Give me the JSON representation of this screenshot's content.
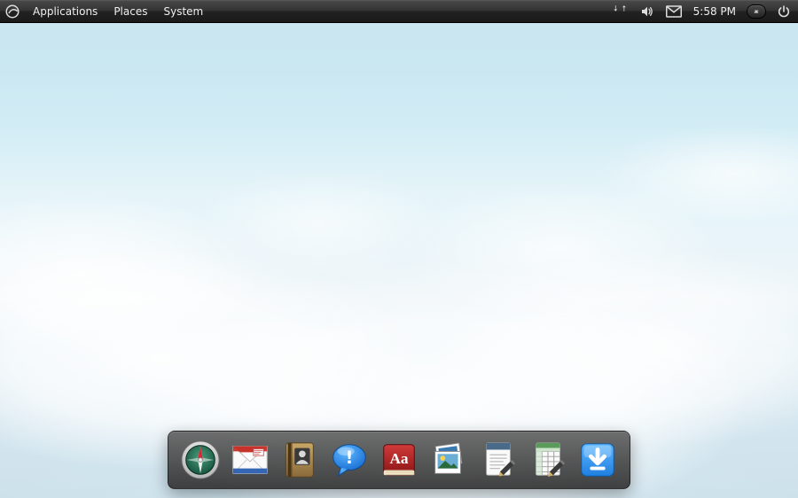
{
  "panel": {
    "menus": {
      "applications": "Applications",
      "places": "Places",
      "system": "System"
    },
    "clock": "5:58 PM"
  },
  "tray": {
    "network": "network-icon",
    "volume": "volume-icon",
    "mail": "mail-icon",
    "user": "user-switch-icon",
    "power": "power-icon"
  },
  "dock": {
    "items": [
      {
        "name": "compass-icon",
        "label": "Web Browser"
      },
      {
        "name": "mail-app-icon",
        "label": "Mail"
      },
      {
        "name": "contacts-icon",
        "label": "Address Book"
      },
      {
        "name": "chat-icon",
        "label": "Messaging"
      },
      {
        "name": "dictionary-icon",
        "label": "Dictionary",
        "glyph": "Aa"
      },
      {
        "name": "photos-icon",
        "label": "Photos"
      },
      {
        "name": "text-editor-icon",
        "label": "Text Editor"
      },
      {
        "name": "spreadsheet-icon",
        "label": "Spreadsheet"
      },
      {
        "name": "downloads-icon",
        "label": "Downloads"
      }
    ]
  }
}
